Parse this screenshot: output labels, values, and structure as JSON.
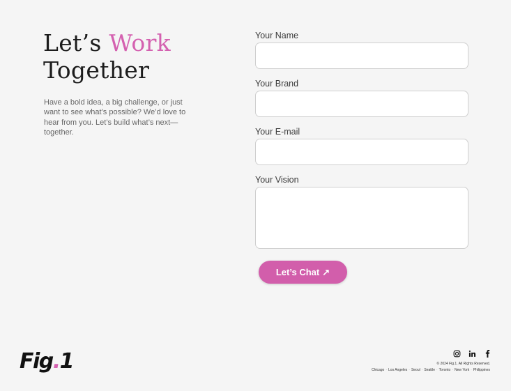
{
  "hero": {
    "title_prefix": "Let’s ",
    "title_accent": "Work",
    "title_line2": "Together",
    "intro": "Have a bold idea, a big challenge, or just want to see what’s possible? We’d love to hear from you. Let’s build what’s next—together."
  },
  "form": {
    "name_label": "Your Name",
    "name_value": "",
    "brand_label": "Your Brand",
    "brand_value": "",
    "email_label": "Your E-mail",
    "email_value": "",
    "vision_label": "Your Vision",
    "vision_value": "",
    "submit_label": "Let’s Chat",
    "submit_icon": "↗"
  },
  "footer": {
    "logo_main": "Fig",
    "logo_dot": ".",
    "logo_num": "1",
    "socials": [
      "instagram-icon",
      "linkedin-icon",
      "facebook-icon"
    ],
    "copyright": "© 2024 Fig.1. All Rights Reserved.",
    "cities": [
      "Chicago",
      "Los Angeles",
      "Seoul",
      "Seattle",
      "Toronto",
      "New York",
      "Philippines"
    ],
    "separator": "·"
  },
  "colors": {
    "accent": "#d461b0",
    "button": "#d25eab",
    "background": "#f5f5f5"
  }
}
